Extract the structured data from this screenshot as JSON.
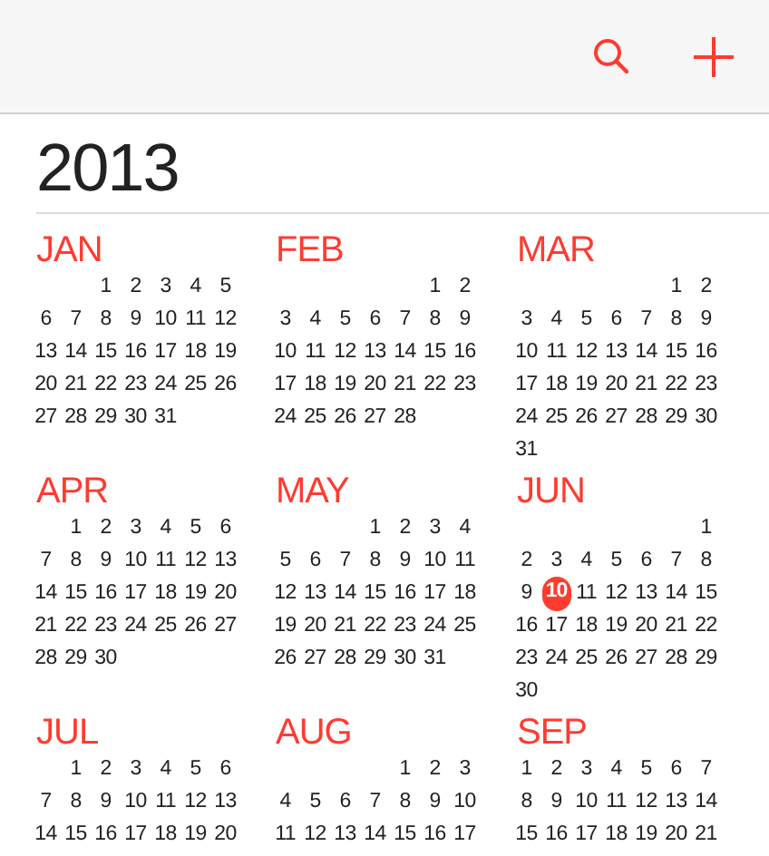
{
  "toolbar": {
    "buttons": [
      {
        "kind": "search"
      },
      {
        "kind": "add"
      }
    ]
  },
  "year": "2013",
  "months": [
    {
      "name": "JAN",
      "weeks": [
        [
          "1",
          "2",
          "3",
          "4",
          "5"
        ],
        [
          "6",
          "7",
          "8",
          "9",
          "10",
          "11",
          "12"
        ],
        [
          "13",
          "14",
          "15",
          "16",
          "17",
          "18",
          "19"
        ],
        [
          "20",
          "21",
          "22",
          "23",
          "24",
          "25",
          "26"
        ],
        [
          "27",
          "28",
          "29",
          "30",
          "31"
        ]
      ]
    },
    {
      "name": "FEB",
      "weeks": [
        [
          "1",
          "2"
        ],
        [
          "3",
          "4",
          "5",
          "6",
          "7",
          "8",
          "9"
        ],
        [
          "10",
          "11",
          "12",
          "13",
          "14",
          "15",
          "16"
        ],
        [
          "17",
          "18",
          "19",
          "20",
          "21",
          "22",
          "23"
        ],
        [
          "24",
          "25",
          "26",
          "27",
          "28"
        ]
      ]
    },
    {
      "name": "MAR",
      "weeks": [
        [
          "1",
          "2"
        ],
        [
          "3",
          "4",
          "5",
          "6",
          "7",
          "8",
          "9"
        ],
        [
          "10",
          "11",
          "12",
          "13",
          "14",
          "15",
          "16"
        ],
        [
          "17",
          "18",
          "19",
          "20",
          "21",
          "22",
          "23"
        ],
        [
          "24",
          "25",
          "26",
          "27",
          "28",
          "29",
          "30"
        ],
        [
          "31"
        ]
      ]
    },
    {
      "name": "APR",
      "weeks": [
        [
          "1",
          "2",
          "3",
          "4",
          "5",
          "6"
        ],
        [
          "7",
          "8",
          "9",
          "10",
          "11",
          "12",
          "13"
        ],
        [
          "14",
          "15",
          "16",
          "17",
          "18",
          "19",
          "20"
        ],
        [
          "21",
          "22",
          "23",
          "24",
          "25",
          "26",
          "27"
        ],
        [
          "28",
          "29",
          "30"
        ]
      ]
    },
    {
      "name": "MAY",
      "weeks": [
        [
          "1",
          "2",
          "3",
          "4"
        ],
        [
          "5",
          "6",
          "7",
          "8",
          "9",
          "10",
          "11"
        ],
        [
          "12",
          "13",
          "14",
          "15",
          "16",
          "17",
          "18"
        ],
        [
          "19",
          "20",
          "21",
          "22",
          "23",
          "24",
          "25"
        ],
        [
          "26",
          "27",
          "28",
          "29",
          "30",
          "31"
        ]
      ]
    },
    {
      "name": "JUN",
      "weeks": [
        [
          "1"
        ],
        [
          "2",
          "3",
          "4",
          "5",
          "6",
          "7",
          "8"
        ],
        [
          "9",
          {
            "text": "10",
            "today": true
          },
          "11",
          "12",
          "13",
          "14",
          "15"
        ],
        [
          "16",
          "17",
          "18",
          "19",
          "20",
          "21",
          "22"
        ],
        [
          "23",
          "24",
          "25",
          "26",
          "27",
          "28",
          "29"
        ],
        [
          "30"
        ]
      ]
    },
    {
      "name": "JUL",
      "weeks": [
        [
          "1",
          "2",
          "3",
          "4",
          "5",
          "6"
        ],
        [
          "7",
          "8",
          "9",
          "10",
          "11",
          "12",
          "13"
        ],
        [
          "14",
          "15",
          "16",
          "17",
          "18",
          "19",
          "20"
        ]
      ]
    },
    {
      "name": "AUG",
      "weeks": [
        [
          "1",
          "2",
          "3"
        ],
        [
          "4",
          "5",
          "6",
          "7",
          "8",
          "9",
          "10"
        ],
        [
          "11",
          "12",
          "13",
          "14",
          "15",
          "16",
          "17"
        ]
      ]
    },
    {
      "name": "SEP",
      "weeks": [
        [
          "1",
          "2",
          "3",
          "4",
          "5",
          "6",
          "7"
        ],
        [
          "8",
          "9",
          "10",
          "11",
          "12",
          "13",
          "14"
        ],
        [
          "15",
          "16",
          "17",
          "18",
          "19",
          "20",
          "21"
        ]
      ]
    }
  ]
}
